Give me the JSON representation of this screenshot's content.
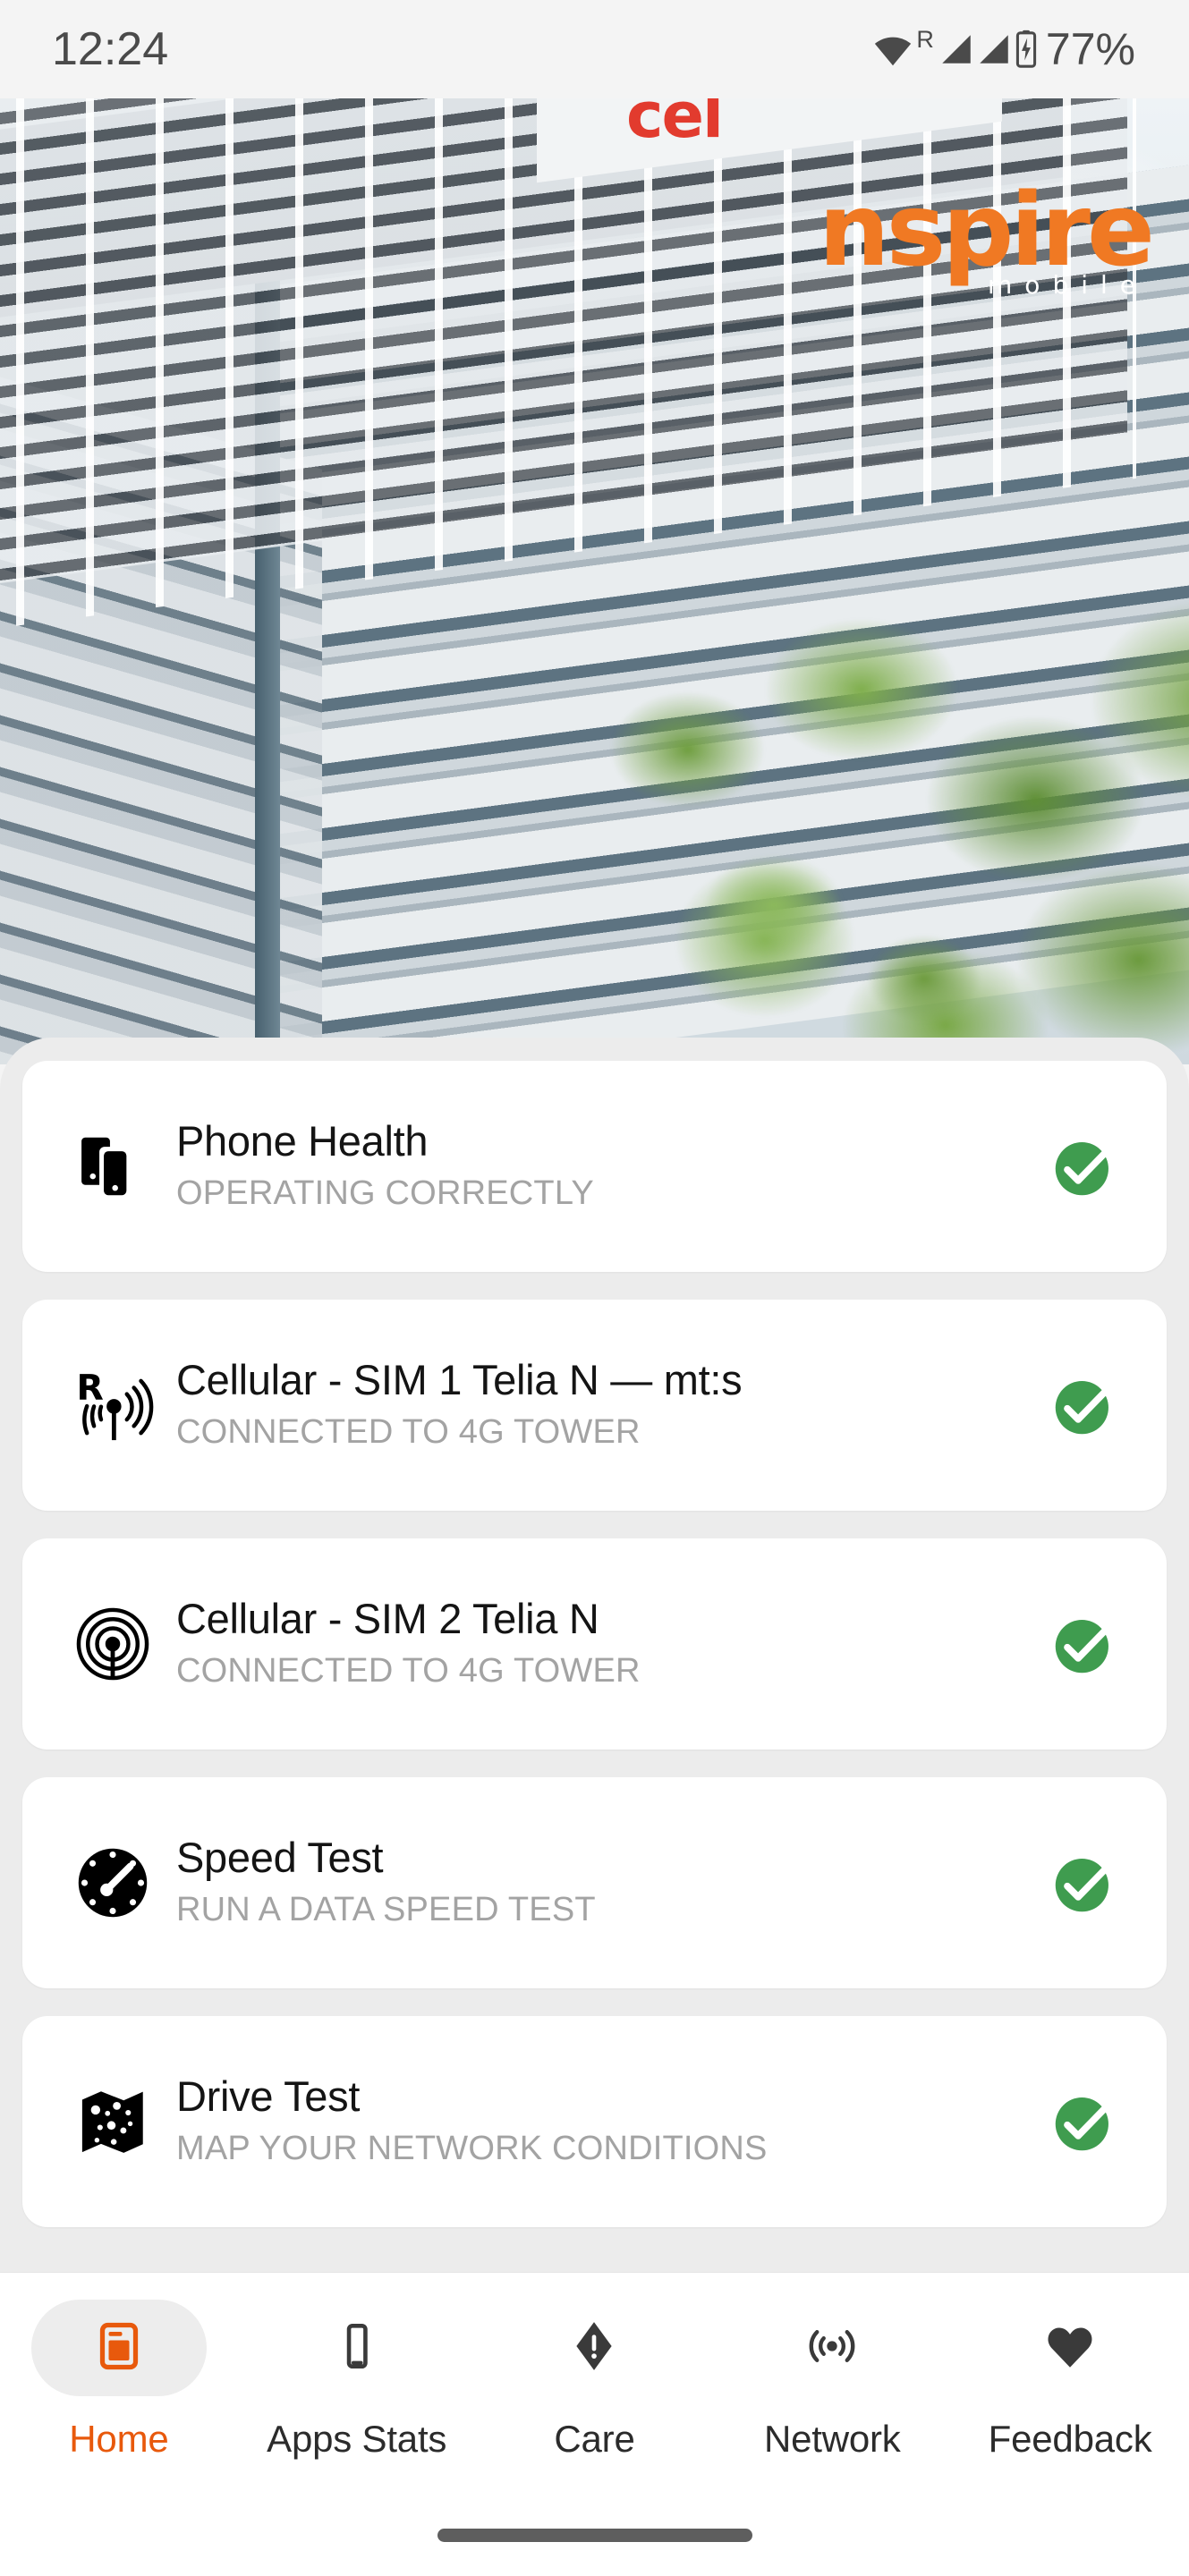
{
  "status_bar": {
    "time": "12:24",
    "wifi_icon": "wifi-icon",
    "roaming_label": "R",
    "signal_icon_1": "signal-bars-icon",
    "signal_icon_2": "signal-bars-icon",
    "battery_icon": "battery-charging-icon",
    "battery_percent": "77%"
  },
  "hero": {
    "logo_main": "nspire",
    "logo_sub": "mobile",
    "logo_color": "#f07923",
    "sign_text": "cel",
    "image_description": "office-building-photo"
  },
  "cards": [
    {
      "icon": "devices-icon",
      "title": "Phone Health",
      "subtitle": "OPERATING CORRECTLY",
      "status": "ok",
      "badge": "green-check-icon"
    },
    {
      "icon": "roaming-tower-icon",
      "title": "Cellular - SIM 1 Telia N — mt:s",
      "subtitle": "CONNECTED TO 4G TOWER",
      "status": "ok",
      "badge": "green-check-icon"
    },
    {
      "icon": "tower-icon",
      "title": "Cellular - SIM 2 Telia N",
      "subtitle": "CONNECTED TO 4G TOWER",
      "status": "ok",
      "badge": "green-check-icon"
    },
    {
      "icon": "speedometer-icon",
      "title": "Speed Test",
      "subtitle": "RUN A DATA SPEED TEST",
      "status": "ok",
      "badge": "green-check-icon"
    },
    {
      "icon": "map-icon",
      "title": "Drive Test",
      "subtitle": "MAP YOUR NETWORK CONDITIONS",
      "status": "ok",
      "badge": "green-check-icon"
    }
  ],
  "bottom_nav": {
    "active_index": 0,
    "items": [
      {
        "label": "Home",
        "icon": "dashboard-icon",
        "active": true
      },
      {
        "label": "Apps Stats",
        "icon": "phone-icon",
        "active": false
      },
      {
        "label": "Care",
        "icon": "alert-diamond-icon",
        "active": false
      },
      {
        "label": "Network",
        "icon": "broadcast-icon",
        "active": false
      },
      {
        "label": "Feedback",
        "icon": "heart-icon",
        "active": false
      }
    ]
  },
  "colors": {
    "accent": "#e8590c",
    "logo_orange": "#f07923",
    "status_green": "#3f9c4f",
    "sheet_bg": "#ececec",
    "card_bg": "#ffffff",
    "subtitle_gray": "#a3a3a3"
  },
  "system": {
    "gesture_bar": "home-gesture-bar"
  }
}
